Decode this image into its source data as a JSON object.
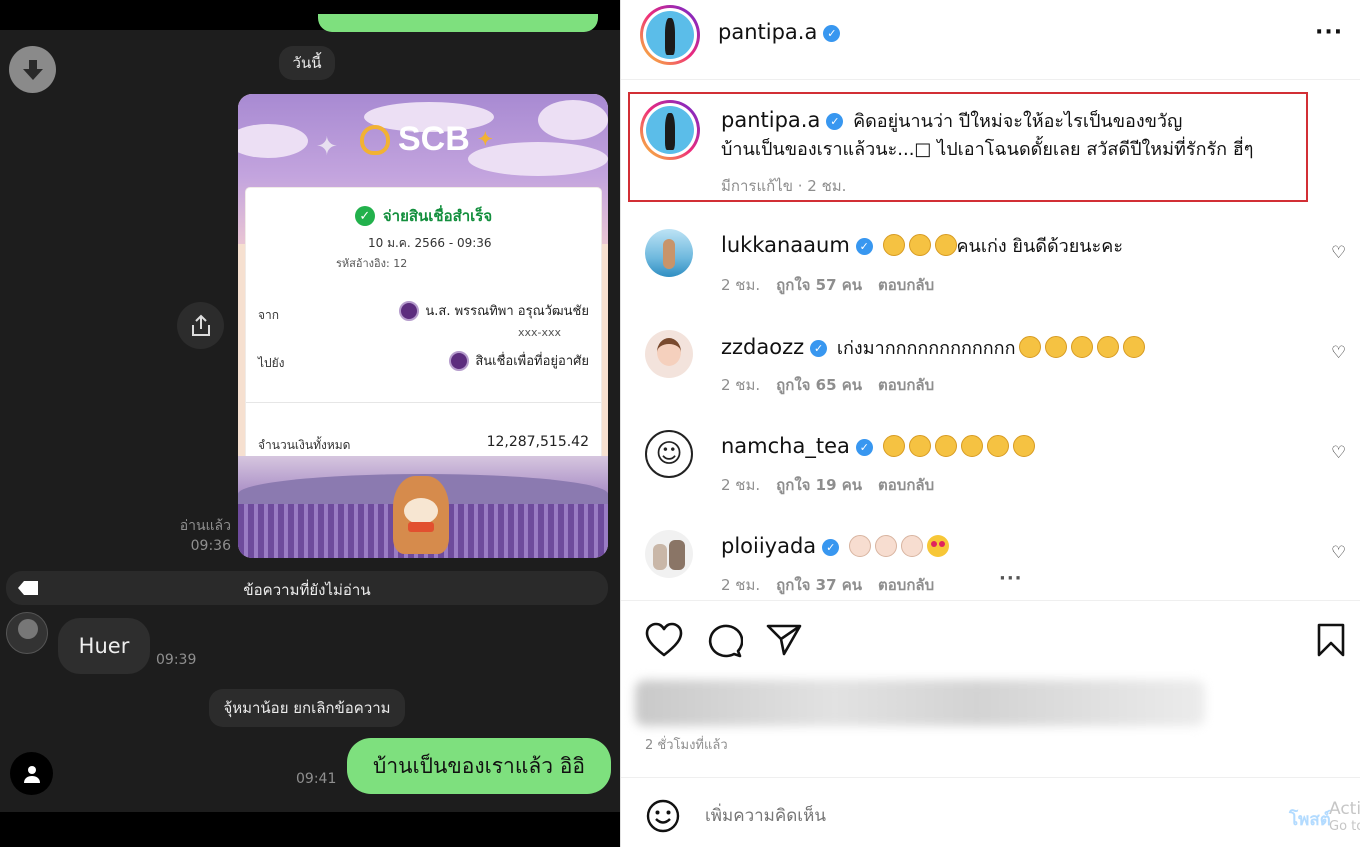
{
  "chat": {
    "date_chip": "วันนี้",
    "receipt": {
      "brand": "SCB",
      "status": "จ่ายสินเชื่อสำเร็จ",
      "datetime": "10 ม.ค. 2566 - 09:36",
      "ref_label": "รหัสอ้างอิง: 12",
      "from_label": "จาก",
      "from_name": "น.ส. พรรณทิพา อรุณวัฒนชัย",
      "from_account": "xxx-xxx",
      "to_label": "ไปยัง",
      "to_name": "สินเชื่อเพื่อที่อยู่อาศัย",
      "total_label": "จำนวนเงินทั้งหมด",
      "total_amount": "12,287,515.42"
    },
    "read_label": "อ่านแล้ว",
    "read_time": "09:36",
    "unread_divider": "ข้อความที่ยังไม่อ่าน",
    "incoming_text": "Huer",
    "incoming_time": "09:39",
    "unsend_notice": "จุ้หมาน้อย ยกเลิกข้อความ",
    "outgoing_text": "บ้านเป็นของเราแล้ว อิอิ",
    "outgoing_time": "09:41"
  },
  "post": {
    "username": "pantipa.a",
    "more_icon": "more-horizontal-icon",
    "caption_line1": "คิดอยู่นานว่า ปีใหม่จะให้อะไรเป็นของขวัญ",
    "caption_line2": "บ้านเป็นของเราแล้วนะ...□ ไปเอาโฉนดดั้ยเลย สวัสดีปีใหม่ที่รักรัก ฮี่ๆ",
    "caption_meta": "มีการแก้ไข · 2 ชม.",
    "comments": [
      {
        "user": "lukkanaaum",
        "text": "คนเก่ง ยินดีด้วยนะคะ",
        "time": "2 ชม.",
        "likes": "ถูกใจ 57 คน",
        "reply": "ตอบกลับ"
      },
      {
        "user": "zzdaozz",
        "text": "เก่งมากกกกกกกกกกกก",
        "time": "2 ชม.",
        "likes": "ถูกใจ 65 คน",
        "reply": "ตอบกลับ"
      },
      {
        "user": "namcha_tea",
        "text": "",
        "time": "2 ชม.",
        "likes": "ถูกใจ 19 คน",
        "reply": "ตอบกลับ"
      },
      {
        "user": "ploiiyada",
        "text": "",
        "time": "2 ชม.",
        "likes": "ถูกใจ 37 คน",
        "reply": "ตอบกลับ"
      }
    ],
    "time_ago": "2 ชั่วโมงที่แล้ว",
    "comment_placeholder": "เพิ่มความคิดเห็น",
    "post_button": "โพสต์",
    "activate_line1": "Acti",
    "activate_line2": "Go to"
  },
  "colors": {
    "line_green": "#7ee07e",
    "ig_verified": "#3897f0",
    "highlight_red": "#d22f35"
  }
}
